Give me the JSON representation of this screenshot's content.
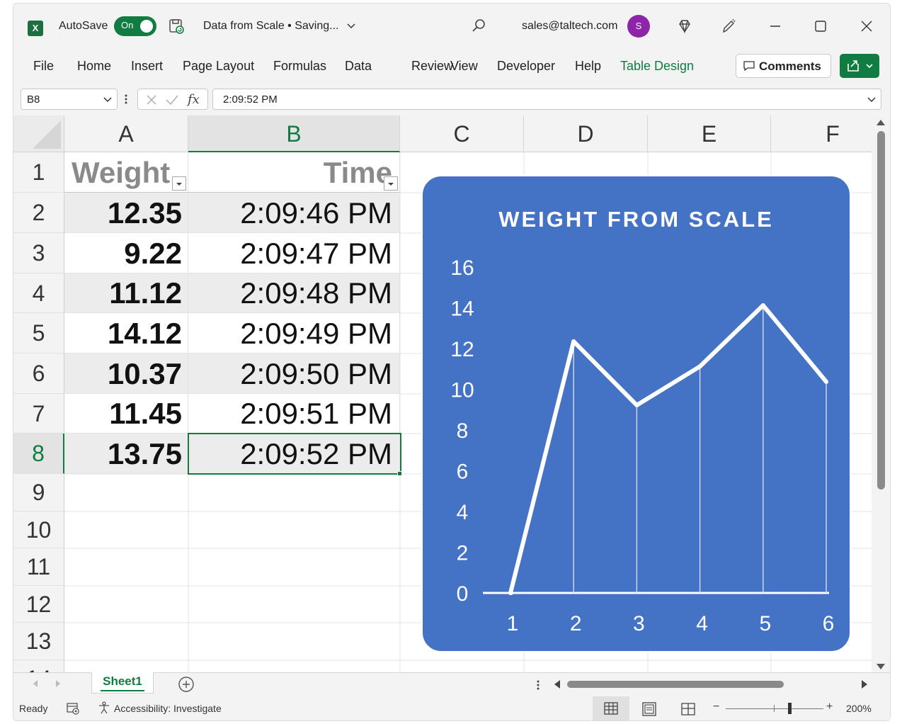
{
  "titlebar": {
    "app_logo": "X",
    "autosave_label": "AutoSave",
    "autosave_state": "On",
    "doc_title": "Data from Scale • Saving...",
    "account_email": "sales@taltech.com",
    "avatar_initial": "S",
    "icons": [
      "excel-logo-icon",
      "save-icon",
      "chevron-down-icon",
      "search-icon",
      "diamond-icon",
      "pen-icon",
      "minimize-icon",
      "maximize-icon",
      "close-icon"
    ]
  },
  "menu": {
    "items": [
      "File",
      "Home",
      "Insert",
      "Page Layout",
      "Formulas",
      "Data",
      "Review",
      "View",
      "Developer",
      "Help",
      "Table Design"
    ],
    "comments_label": "Comments",
    "accent_color": "#107c41"
  },
  "formula_bar": {
    "name_box": "B8",
    "fx_label": "fx",
    "value": "2:09:52 PM"
  },
  "grid": {
    "columns": [
      "A",
      "B",
      "C",
      "D",
      "E",
      "F"
    ],
    "rows": [
      "1",
      "2",
      "3",
      "4",
      "5",
      "6",
      "7",
      "8",
      "9",
      "10",
      "11",
      "12",
      "13",
      "14"
    ],
    "selected_column": "B",
    "selected_row": "8",
    "table_headers": [
      "Weight",
      "Time"
    ],
    "table_rows": [
      [
        "12.35",
        "2:09:46 PM"
      ],
      [
        "9.22",
        "2:09:47 PM"
      ],
      [
        "11.12",
        "2:09:48 PM"
      ],
      [
        "14.12",
        "2:09:49 PM"
      ],
      [
        "10.37",
        "2:09:50 PM"
      ],
      [
        "11.45",
        "2:09:51 PM"
      ],
      [
        "13.75",
        "2:09:52 PM"
      ]
    ]
  },
  "chart_data": {
    "type": "line",
    "title": "WEIGHT FROM SCALE",
    "categories": [
      "1",
      "2",
      "3",
      "4",
      "5",
      "6"
    ],
    "series": [
      {
        "values": [
          0,
          12.35,
          9.22,
          11.12,
          14.12,
          10.37
        ]
      }
    ],
    "ylim": [
      0,
      16
    ],
    "yticks": [
      "0",
      "2",
      "4",
      "6",
      "8",
      "10",
      "12",
      "14",
      "16"
    ],
    "drop_lines": true,
    "grid": false,
    "legend": "none",
    "background": "#4472c4",
    "line_color": "#ffffff"
  },
  "sheets": {
    "tabs": [
      "Sheet1"
    ],
    "active": "Sheet1"
  },
  "status": {
    "ready": "Ready",
    "accessibility": "Accessibility: Investigate",
    "zoom_minus": "−",
    "zoom_plus": "+",
    "zoom": "200%"
  }
}
